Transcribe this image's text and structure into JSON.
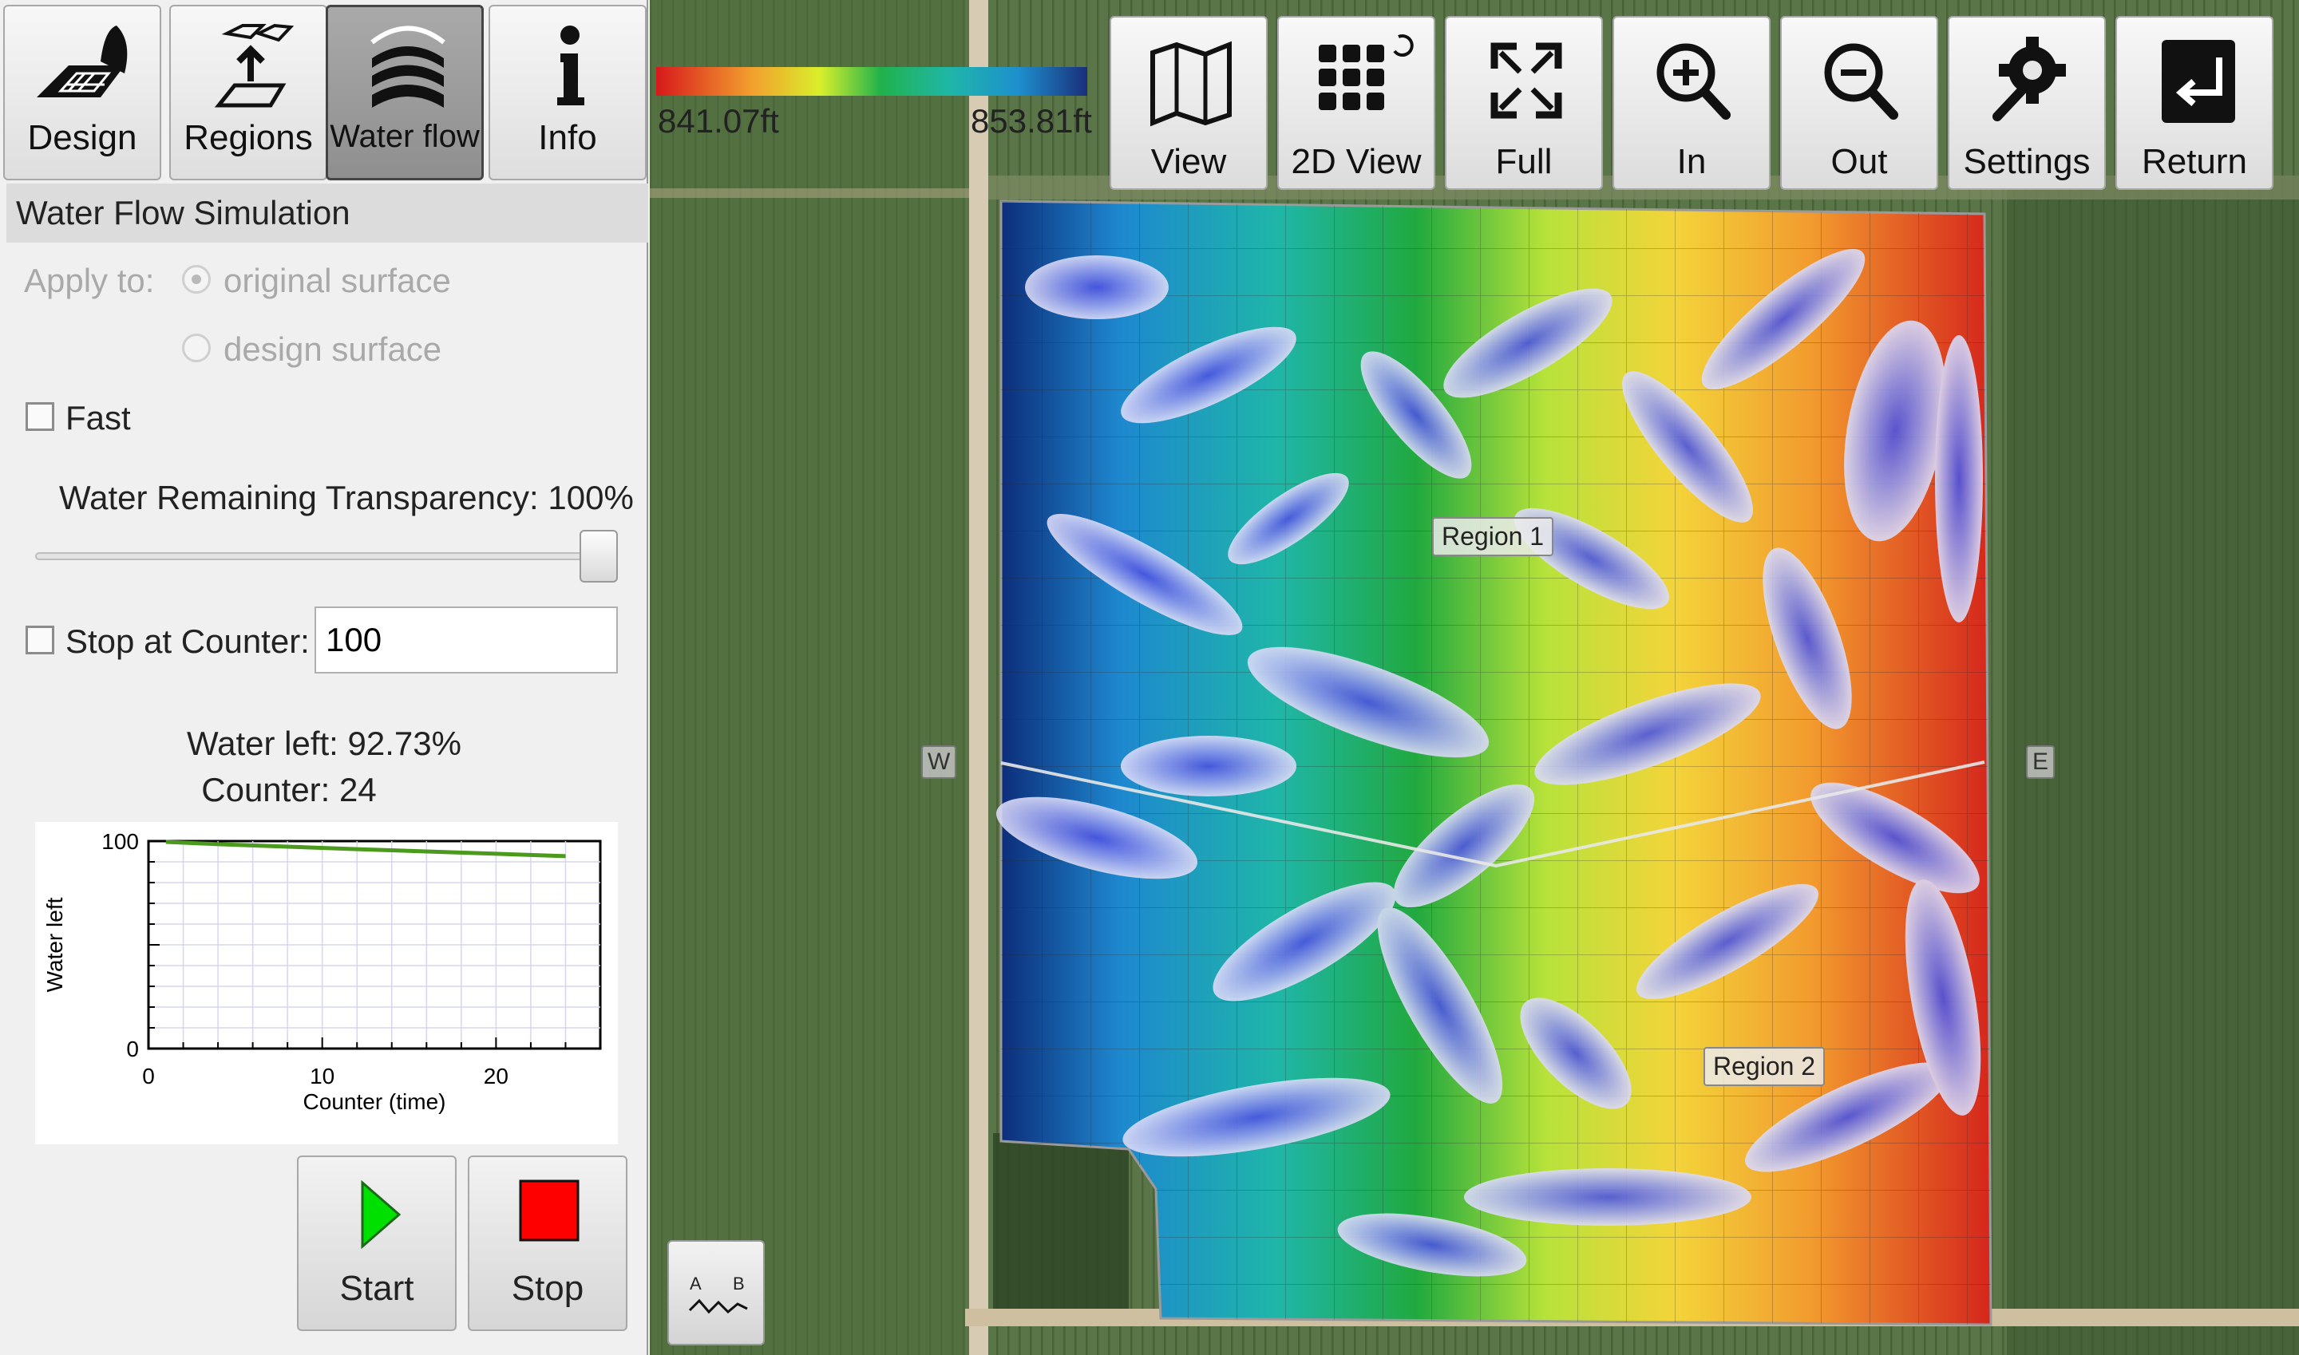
{
  "tabs": [
    {
      "label": "Design",
      "icon": "design-grid-icon",
      "active": false
    },
    {
      "label": "Regions",
      "icon": "regions-icon",
      "active": false
    },
    {
      "label": "Water flow",
      "icon": "water-flow-icon",
      "active": true
    },
    {
      "label": "Info",
      "icon": "info-icon",
      "active": false
    }
  ],
  "panel": {
    "title": "Water Flow Simulation",
    "apply_to_label": "Apply to:",
    "options": [
      {
        "label": "original surface",
        "selected": true
      },
      {
        "label": "design surface",
        "selected": false
      }
    ],
    "fast_label": "Fast",
    "fast_checked": false,
    "transparency_label": "Water Remaining Transparency:",
    "transparency_value": "100%",
    "transparency_fraction": 1.0,
    "stop_counter_label": "Stop at Counter:",
    "stop_counter_checked": false,
    "stop_counter_value": "100",
    "water_left_text": "Water left: 92.73%",
    "counter_text": "Counter: 24",
    "start_label": "Start",
    "stop_label": "Stop"
  },
  "chart_data": {
    "type": "line",
    "xlabel": "Counter (time)",
    "ylabel": "Water left",
    "xlim": [
      0,
      26
    ],
    "ylim": [
      0,
      100
    ],
    "x_ticks": [
      "0",
      "10",
      "20"
    ],
    "y_ticks": [
      "0",
      "100"
    ],
    "grid": true,
    "series": [
      {
        "x": [
          1,
          4,
          8,
          12,
          16,
          20,
          24
        ],
        "y": [
          99.6,
          98.5,
          97.3,
          96.1,
          95.0,
          93.9,
          92.73
        ],
        "color": "#4b9a1e"
      }
    ]
  },
  "legend": {
    "min_label": "841.07ft",
    "max_label": "853.81ft",
    "colors": [
      "#d7191c",
      "#f29e2e",
      "#d9ef2b",
      "#21b24b",
      "#1fb6a8",
      "#1e90ce",
      "#1a2f7a"
    ]
  },
  "toolbar": [
    {
      "label": "View",
      "icon": "map-view-icon"
    },
    {
      "label": "2D View",
      "icon": "grid-2d-icon"
    },
    {
      "label": "Full",
      "icon": "full-extent-icon"
    },
    {
      "label": "In",
      "icon": "zoom-in-icon"
    },
    {
      "label": "Out",
      "icon": "zoom-out-icon"
    },
    {
      "label": "Settings",
      "icon": "settings-icon"
    },
    {
      "label": "Return",
      "icon": "return-icon"
    }
  ],
  "map": {
    "region1_label": "Region 1",
    "region2_label": "Region 2",
    "west_label": "W",
    "east_label": "E",
    "profile_a": "A",
    "profile_b": "B",
    "colors": {
      "field_dark": "#3f5a33",
      "field_light": "#5e7a4a",
      "road": "#d6c8ae"
    }
  }
}
